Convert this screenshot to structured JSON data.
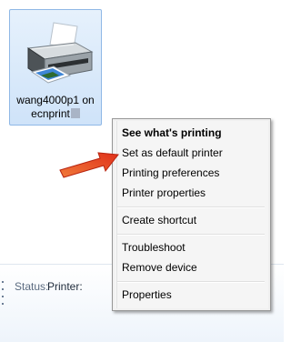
{
  "printer": {
    "name_line1": "wang4000p1 on",
    "name_line2": "ecnprint"
  },
  "context_menu": {
    "items": [
      {
        "label": "See what's printing",
        "bold": true
      },
      {
        "label": "Set as default printer"
      },
      {
        "label": "Printing preferences"
      },
      {
        "label": "Printer properties"
      },
      {
        "label": "Create shortcut"
      },
      {
        "label": "Troubleshoot"
      },
      {
        "label": "Remove device"
      },
      {
        "label": "Properties"
      }
    ]
  },
  "details": {
    "status_label": "Status:",
    "status_value": "Printer:"
  },
  "colors": {
    "annotation_arrow": "#e8371a",
    "selection_border": "#8fb8e6",
    "selection_fill": "#dbeaf9"
  }
}
